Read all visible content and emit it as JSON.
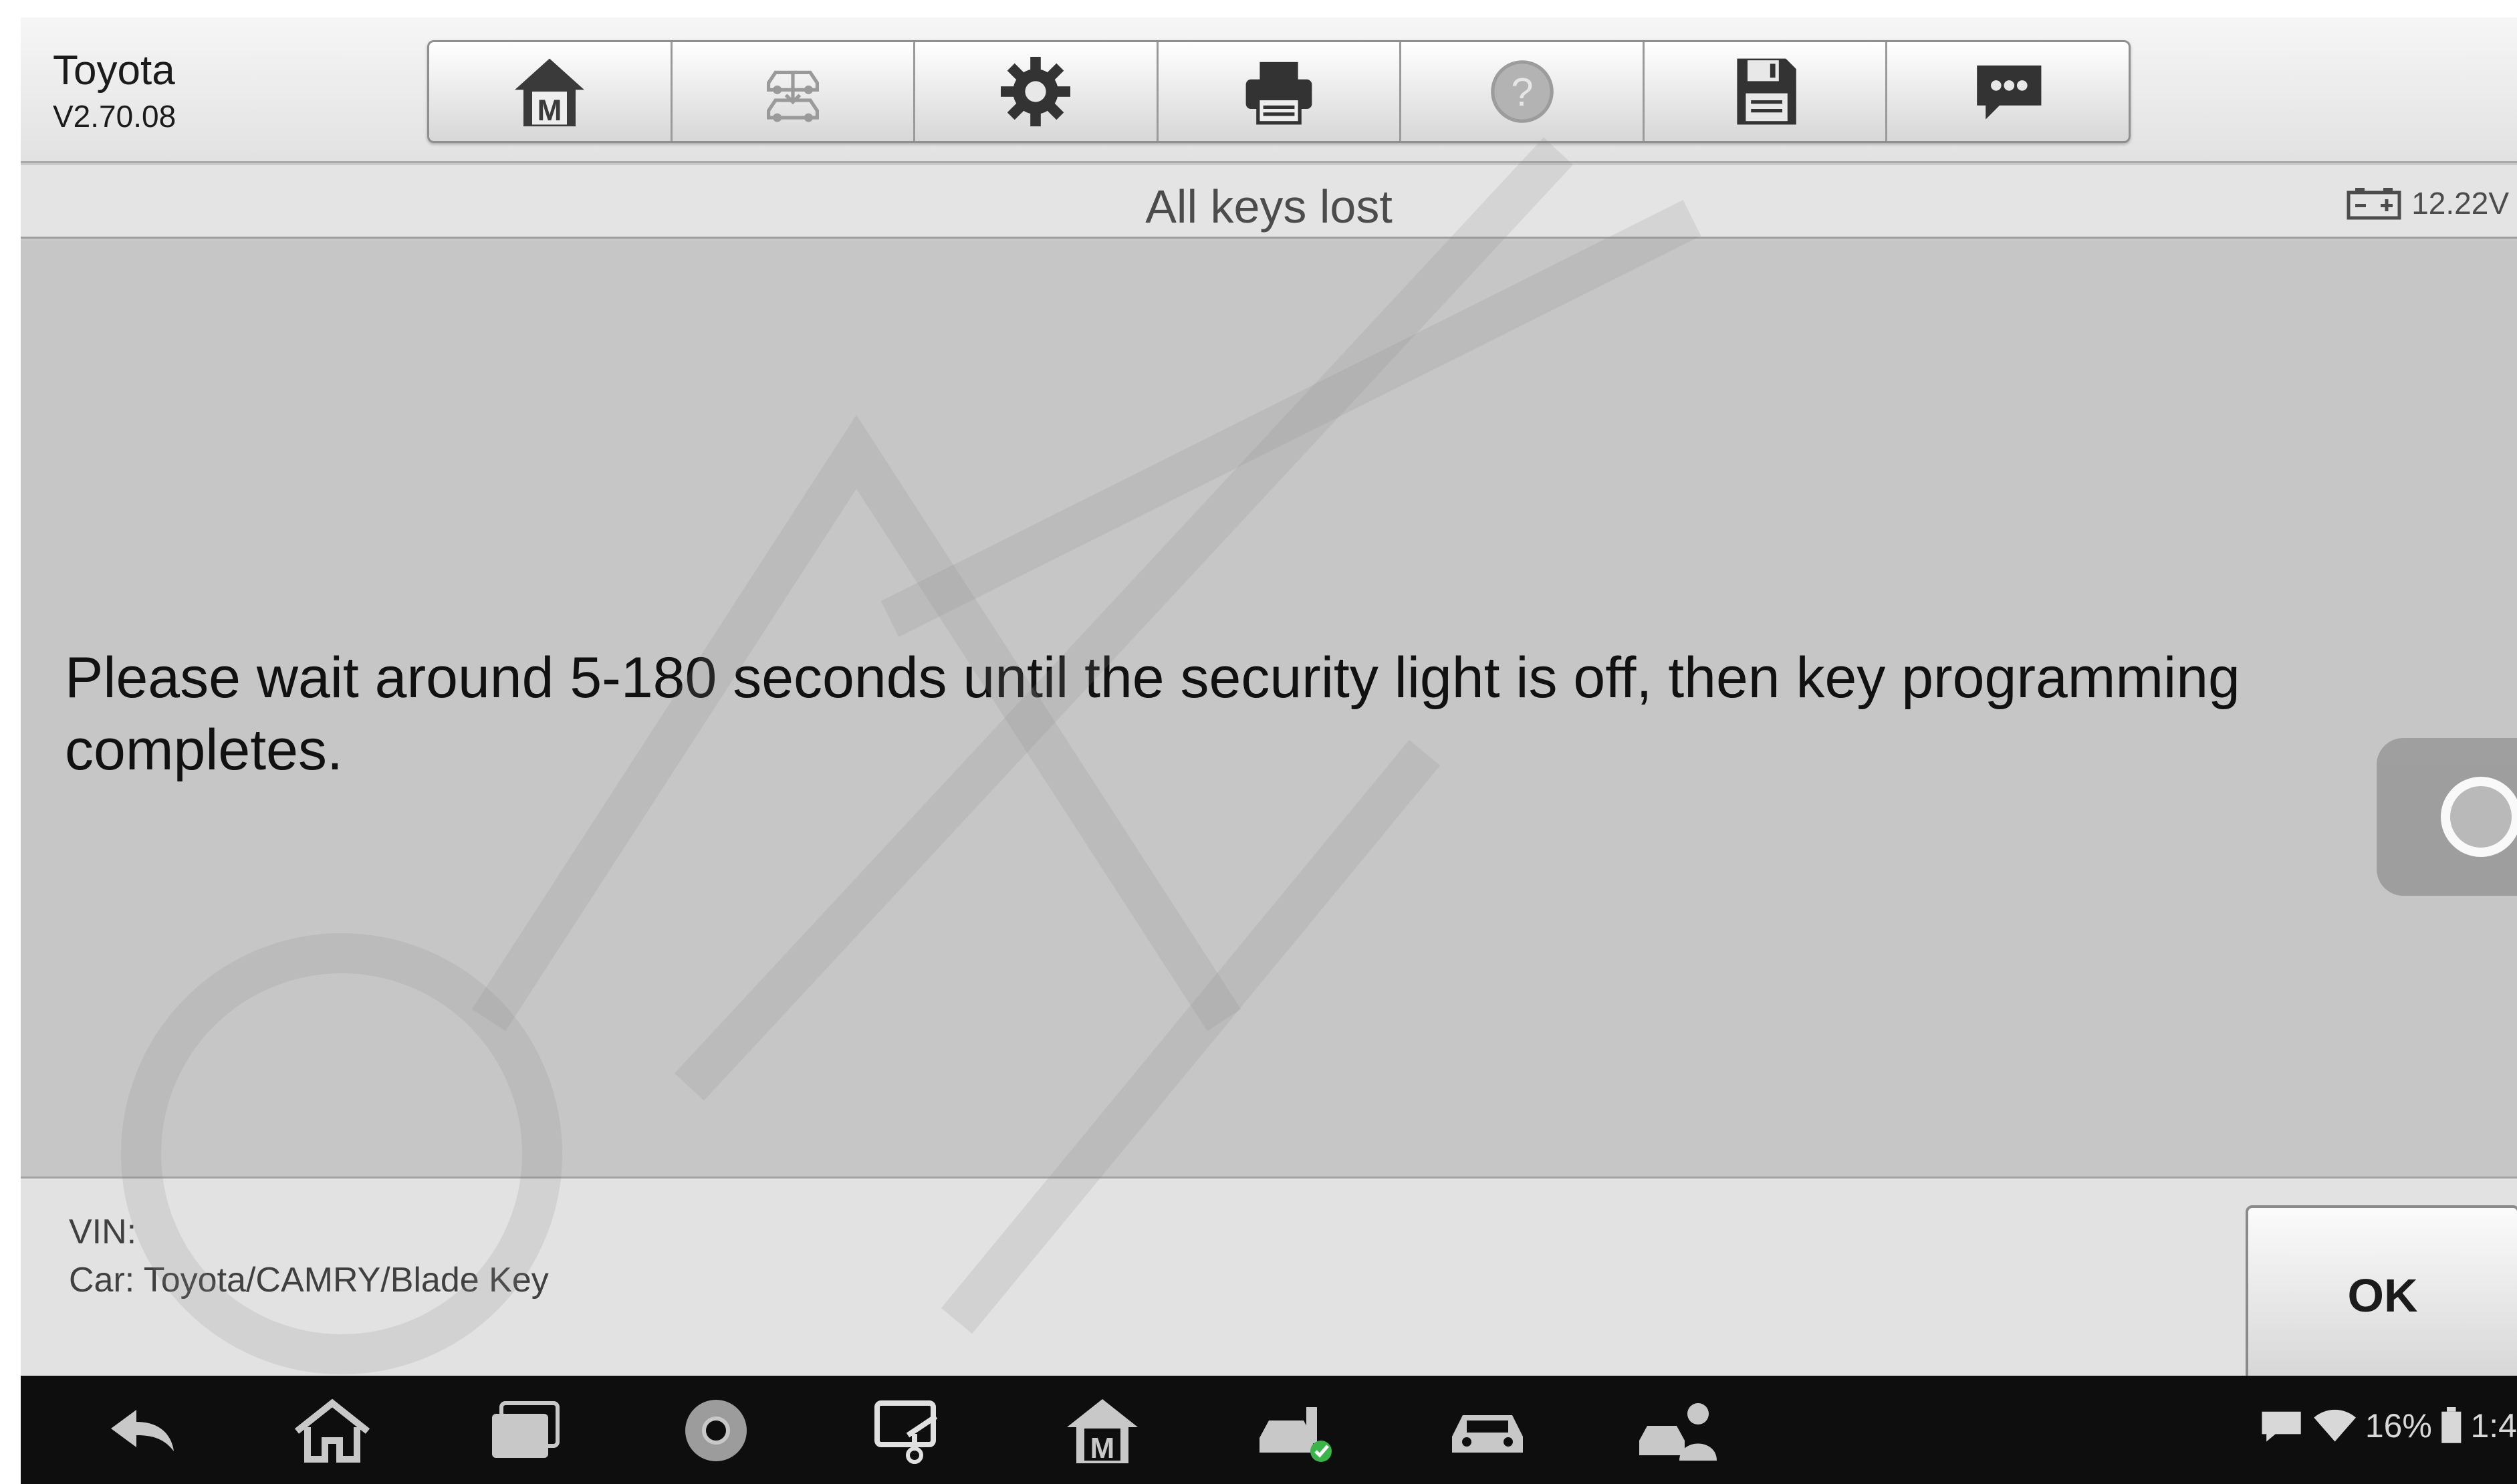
{
  "app": {
    "brand": "Toyota",
    "version": "V2.70.08"
  },
  "toolbar": {
    "buttons": [
      {
        "icon": "home-m-icon"
      },
      {
        "icon": "vehicle-swap-icon"
      },
      {
        "icon": "gear-icon"
      },
      {
        "icon": "printer-icon"
      },
      {
        "icon": "help-icon"
      },
      {
        "icon": "save-icon"
      },
      {
        "icon": "feedback-icon"
      }
    ]
  },
  "titlebar": {
    "title": "All keys lost",
    "voltage": "12.22V"
  },
  "main": {
    "message": "Please wait around 5-180 seconds until the security light is off, then key programming completes."
  },
  "footer": {
    "vin_label": "VIN:",
    "car_label": "Car: Toyota/CAMRY/Blade Key",
    "ok_label": "OK"
  },
  "navbar": {
    "icons": [
      "back-icon",
      "home-icon",
      "recent-apps-icon",
      "chrome-icon",
      "screen-capture-icon",
      "maxisys-m-icon",
      "vehicle-check-icon",
      "car-icon",
      "car-service-icon"
    ]
  },
  "status": {
    "battery": "16%",
    "time": "1:4"
  },
  "colors": {
    "background": "#c6c6c6",
    "header": "#e2e2e2",
    "navbar": "#0e0e0e"
  }
}
